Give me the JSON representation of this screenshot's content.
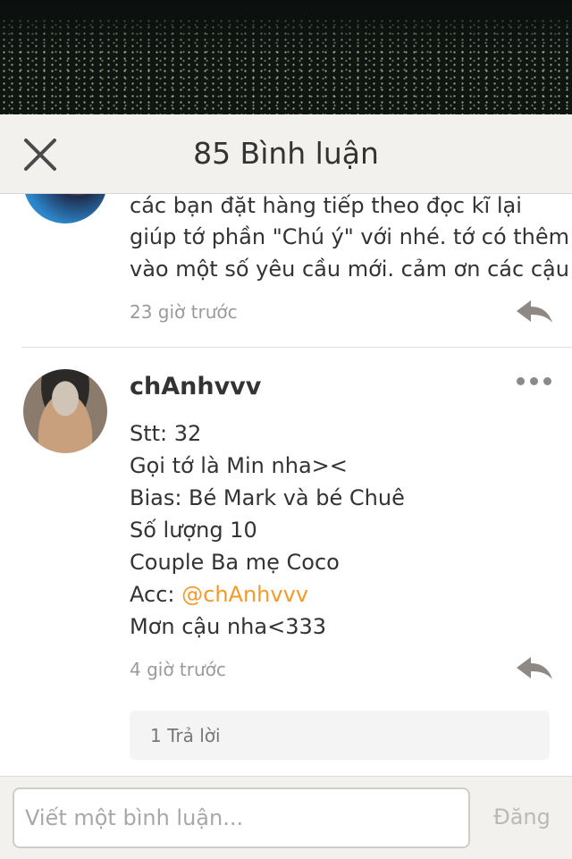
{
  "header": {
    "title": "85 Bình luận",
    "close_icon": "close-icon"
  },
  "comments": [
    {
      "lines": [
        "các bạn đặt hàng tiếp theo đọc kĩ lại",
        "giúp tớ phần \"Chú ý\" với nhé. tớ có thêm",
        "vào một số yêu cầu mới. cảm ơn các cậu"
      ],
      "time": "23 giờ trước",
      "reply_icon": "reply-icon"
    },
    {
      "username": "chAnhvvv",
      "more_icon": "more-options-icon",
      "lines": [
        "Stt: 32",
        "Gọi tớ là Min nha><",
        "Bias: Bé Mark và bé Chuê",
        "Số lượng 10",
        "Couple Ba mẹ Coco"
      ],
      "acc_label": "Acc:",
      "acc_mention": "@chAnhvvv",
      "last_line": "Mơn cậu nha<333",
      "time": "4 giờ trước",
      "reply_icon": "reply-icon",
      "replies_label": "1 Trả lời"
    }
  ],
  "footer": {
    "input_placeholder": "Viết một bình luận...",
    "post_label": "Đăng"
  },
  "colors": {
    "mention": "#f39a2a",
    "header_bg": "#f2f1ee",
    "time_text": "#9a9a9a",
    "post_disabled": "#b9b9b9"
  }
}
